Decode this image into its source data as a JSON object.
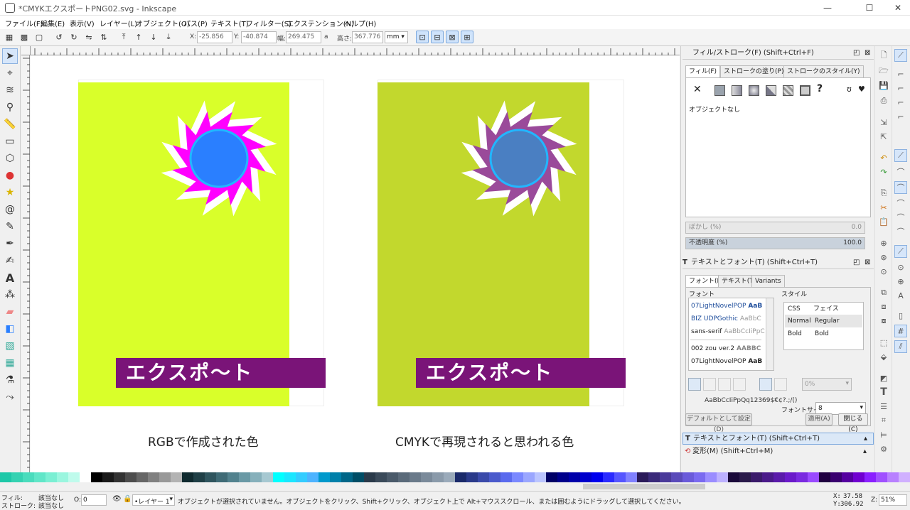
{
  "window": {
    "title": "*CMYKエクスポートPNG02.svg - Inkscape"
  },
  "menu": [
    "ファイル(F)",
    "編集(E)",
    "表示(V)",
    "レイヤー(L)",
    "オブジェクト(O)",
    "パス(P)",
    "テキスト(T)",
    "フィルター(S)",
    "エクステンション(N)",
    "ヘルプ(H)"
  ],
  "toolbar": {
    "x_label": "X:",
    "x_value": "-25.856",
    "y_label": "Y:",
    "y_value": "-40.874",
    "w_label": "幅:",
    "w_value": "269.475",
    "lock_glyph": "a",
    "h_label": "高さ:",
    "h_value": "367.776",
    "unit": "mm"
  },
  "canvas": {
    "left_caption": "RGBで作成された色",
    "right_caption": "CMYKで再現されると思われる色",
    "banner_text": "エクスポ～ト",
    "rgb_colors": {
      "background": "#d9ff2a",
      "star": "#ff00ff",
      "circle": "#2a7fff",
      "circle_stroke": "#22b6ff",
      "banner": "#7a1478"
    },
    "cmyk_colors": {
      "background": "#c2d82d",
      "star": "#9a4a9a",
      "circle": "#4a7fc2",
      "circle_stroke": "#22b6ff",
      "banner": "#7a1478"
    }
  },
  "fill_stroke": {
    "title": "フィル/ストローク(F) (Shift+Ctrl+F)",
    "tabs": [
      "フィル(F)",
      "ストロークの塗り(P)",
      "ストロークのスタイル(Y)"
    ],
    "no_object": "オブジェクトなし",
    "blur_label": "ぼかし (%)",
    "blur_value": "0.0",
    "opacity_label": "不透明度 (%)",
    "opacity_value": "100.0"
  },
  "text_font": {
    "title": "テキストとフォント(T) (Shift+Ctrl+T)",
    "tabs": [
      "フォント(F)",
      "テキスト(T)",
      "Variants"
    ],
    "font_group": "フォント",
    "style_group": "スタイル",
    "fonts": [
      {
        "name": "07LightNovelPOP",
        "sample": "AaB"
      },
      {
        "name": "BIZ UDPGothic",
        "sample": "AaBbC"
      },
      {
        "name": "sans-serif",
        "sample": "AaBbCcIiPpC"
      },
      {
        "name": "002 zou ver.2",
        "sample": "AABBC"
      },
      {
        "name": "07LightNovelPOP",
        "sample": "AaB"
      }
    ],
    "style_headers": [
      "CSS",
      "フェイス"
    ],
    "styles": [
      {
        "css": "Normal",
        "face": "Regular"
      },
      {
        "css": "Bold",
        "face": "Bold"
      }
    ],
    "size_label": "フォントサイ:",
    "size_value": "8",
    "spacing_value": "0%",
    "preview": "AaBbCcIiPpQq12369$€¢?.;/()",
    "default_button": "デフォルトとして設定(D)",
    "apply_button": "適用(A)",
    "close_button": "閉じる(C)"
  },
  "collapsed_panels": [
    "テキストとフォント(T) (Shift+Ctrl+T)",
    "変形(M) (Shift+Ctrl+M)"
  ],
  "status": {
    "fill_label": "フィル:",
    "fill_value": "該当なし",
    "stroke_label": "ストローク:",
    "stroke_value": "該当なし",
    "o_label": "O:",
    "o_value": "0",
    "layer": "•レイヤー 1",
    "message": "オブジェクトが選択されていません。オブジェクトをクリック、Shift+クリック、オブジェクト上で Alt+マウススクロール、または囲むようにドラッグして選択してください。",
    "x_label": "X:",
    "x_value": "37.58",
    "y_label": "Y:",
    "y_value": "306.92",
    "zoom_label": "Z:",
    "zoom_value": "51%"
  },
  "palette": [
    "#1ec8a8",
    "#35d2b2",
    "#4adcbd",
    "#60e6c8",
    "#7aefd3",
    "#9af6df",
    "#bffbec",
    "#ffffff",
    "#000000",
    "#1a1a1a",
    "#333333",
    "#4d4d4d",
    "#666666",
    "#808080",
    "#999999",
    "#b3b3b3",
    "#0f2a2f",
    "#1f3f46",
    "#2f555e",
    "#3f6b76",
    "#52828e",
    "#6a99a5",
    "#86b0bb",
    "#a6c8d1",
    "#00ffff",
    "#1ae6ff",
    "#33ccff",
    "#4db3ff",
    "#0099cc",
    "#0080aa",
    "#006688",
    "#004d66",
    "#2a3a4a",
    "#3a4a5a",
    "#4a5a6a",
    "#5a6a7a",
    "#6a7a8a",
    "#7a8a9a",
    "#8a9aaa",
    "#9aaaba",
    "#1a2a6a",
    "#2a3a8a",
    "#3a4aaa",
    "#4a5acc",
    "#5a6aee",
    "#7a88ff",
    "#9aa6ff",
    "#bac4ff",
    "#000066",
    "#00008b",
    "#0000aa",
    "#0000cc",
    "#0000ee",
    "#2a2aff",
    "#5555ff",
    "#8080ff",
    "#2a1a5a",
    "#3a2a7a",
    "#4a3a9a",
    "#5a4aba",
    "#6a5ada",
    "#7a6af0",
    "#9a8cff",
    "#bcb0ff",
    "#1a0a3a",
    "#2a1a4a",
    "#3a1a6a",
    "#4a1a8a",
    "#5a1aaa",
    "#6a1aca",
    "#7a2ae0",
    "#9a4aff",
    "#200040",
    "#3a0070",
    "#5500a0",
    "#7000d0",
    "#8a20ff",
    "#a050ff",
    "#b880ff",
    "#d0b0ff"
  ]
}
